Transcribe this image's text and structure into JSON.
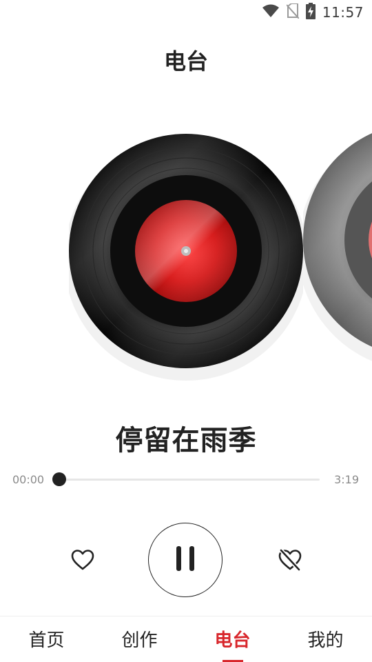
{
  "status_bar": {
    "time": "11:57",
    "icons": [
      "wifi-icon",
      "no-sim-icon",
      "battery-charging-icon"
    ]
  },
  "header": {
    "title": "电台"
  },
  "player": {
    "song_title": "停留在雨季",
    "current_time": "00:00",
    "total_time": "3:19",
    "progress": 0,
    "accent_color": "#d8262b",
    "controls": {
      "like_icon": "heart-outline-icon",
      "play_state_icon": "pause-icon",
      "dislike_icon": "heart-broken-icon"
    }
  },
  "bottom_nav": {
    "items": [
      {
        "label": "首页",
        "active": false
      },
      {
        "label": "创作",
        "active": false
      },
      {
        "label": "电台",
        "active": true
      },
      {
        "label": "我的",
        "active": false
      }
    ],
    "active_color": "#d8262b"
  }
}
